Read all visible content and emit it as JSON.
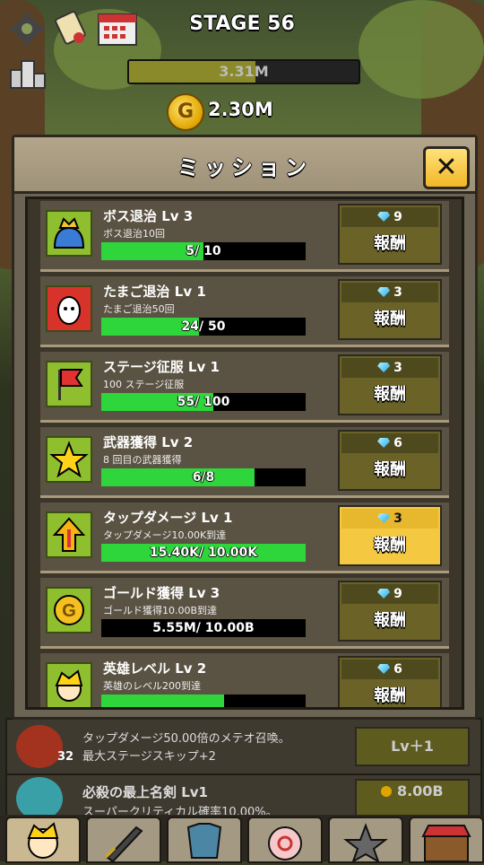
{
  "header": {
    "stage_label": "STAGE 56",
    "boss_hp": "3.31M",
    "boss_hp_fraction": 0.55,
    "gold": "2.30M",
    "coin_letter": "G"
  },
  "panel": {
    "title": "ミッション",
    "close_symbol": "✕",
    "missions": [
      {
        "title": "ボス退治 Lv 3",
        "desc": "ボス退治10回",
        "progress": "5/ 10",
        "fraction": 0.5,
        "reward": "9",
        "button": "報酬",
        "claimable": false
      },
      {
        "title": "たまご退治 Lv 1",
        "desc": "たまご退治50回",
        "progress": "24/ 50",
        "fraction": 0.48,
        "reward": "3",
        "button": "報酬",
        "claimable": false
      },
      {
        "title": "ステージ征服 Lv 1",
        "desc": "100 ステージ征服",
        "progress": "55/ 100",
        "fraction": 0.55,
        "reward": "3",
        "button": "報酬",
        "claimable": false
      },
      {
        "title": "武器獲得 Lv 2",
        "desc": "8 回目の武器獲得",
        "progress": "6/8",
        "fraction": 0.75,
        "reward": "6",
        "button": "報酬",
        "claimable": false
      },
      {
        "title": "タップダメージ Lv 1",
        "desc": "タップダメージ10.00K到達",
        "progress": "15.40K/ 10.00K",
        "fraction": 1.0,
        "reward": "3",
        "button": "報酬",
        "claimable": true
      },
      {
        "title": "ゴールド獲得 Lv 3",
        "desc": "ゴールド獲得10.00B到達",
        "progress": "5.55M/ 10.00B",
        "fraction": 0.0,
        "reward": "9",
        "button": "報酬",
        "claimable": false
      },
      {
        "title": "英雄レベル Lv 2",
        "desc": "英雄のレベル200到達",
        "progress": "",
        "fraction": 0.6,
        "reward": "6",
        "button": "報酬",
        "claimable": false
      }
    ]
  },
  "background_rows": [
    {
      "line1": "タップダメージ50.00倍のメテオ召喚。",
      "line2": "最大ステージスキップ+2",
      "badge": "32",
      "button": "Lv＋1"
    },
    {
      "line1": "必殺の最上名剣 Lv1",
      "line2": "スーパークリティカル確率10.00%。",
      "cost": "8.00B"
    }
  ],
  "colors": {
    "accent": "#f5c841",
    "progress": "#2ed63c",
    "panel": "#6b6353"
  }
}
